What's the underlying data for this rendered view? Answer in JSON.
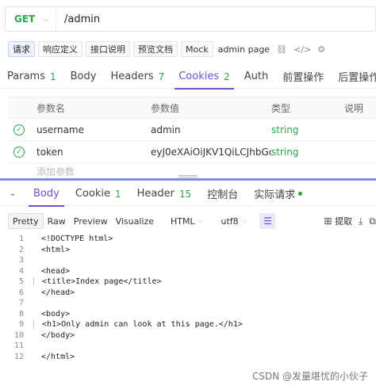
{
  "request": {
    "method": "GET",
    "url": "/admin"
  },
  "subtabs": [
    {
      "label": "请求"
    },
    {
      "label": "响应定义"
    },
    {
      "label": "接口说明"
    },
    {
      "label": "预览文档"
    },
    {
      "label": "Mock"
    },
    {
      "label": "admin page"
    }
  ],
  "request_tabs": [
    {
      "label": "Params",
      "count": "1"
    },
    {
      "label": "Body",
      "count": ""
    },
    {
      "label": "Headers",
      "count": "7"
    },
    {
      "label": "Cookies",
      "count": "2"
    },
    {
      "label": "Auth",
      "count": ""
    },
    {
      "label": "前置操作",
      "count": ""
    },
    {
      "label": "后置操作",
      "count": ""
    }
  ],
  "params_table": {
    "headers": [
      "参数名",
      "参数值",
      "类型",
      "说明"
    ],
    "rows": [
      {
        "name": "username",
        "value": "admin",
        "type": "string"
      },
      {
        "name": "token",
        "value": "eyJ0eXAiOiJKV1QiLCJhbGci",
        "type": "string"
      }
    ],
    "add_placeholder": "添加参数"
  },
  "response_tabs": [
    {
      "label": "Body",
      "count": ""
    },
    {
      "label": "Cookie",
      "count": "1"
    },
    {
      "label": "Header",
      "count": "15"
    },
    {
      "label": "控制台",
      "count": ""
    },
    {
      "label": "实际请求",
      "count": ""
    }
  ],
  "toolbar": {
    "formats": [
      "Pretty",
      "Raw",
      "Preview",
      "Visualize"
    ],
    "language": "HTML",
    "encoding": "utf8",
    "extract_label": "提取"
  },
  "code_lines": [
    {
      "n": "1",
      "text": "<!DOCTYPE html>"
    },
    {
      "n": "2",
      "text": "<html>"
    },
    {
      "n": "3",
      "text": ""
    },
    {
      "n": "4",
      "text": "<head>"
    },
    {
      "n": "5",
      "text": "<title>Index page</title>"
    },
    {
      "n": "6",
      "text": "</head>"
    },
    {
      "n": "7",
      "text": ""
    },
    {
      "n": "8",
      "text": "<body>"
    },
    {
      "n": "9",
      "text": "<h1>Only admin can look at this page.</h1>"
    },
    {
      "n": "10",
      "text": "</body>"
    },
    {
      "n": "11",
      "text": ""
    },
    {
      "n": "12",
      "text": "</html>"
    }
  ],
  "watermark": "CSDN @发量堪忧的小伙子",
  "colors": {
    "accent": "#6d4fd3",
    "success": "#2aa54a",
    "splitter": "#7b8fe6"
  }
}
